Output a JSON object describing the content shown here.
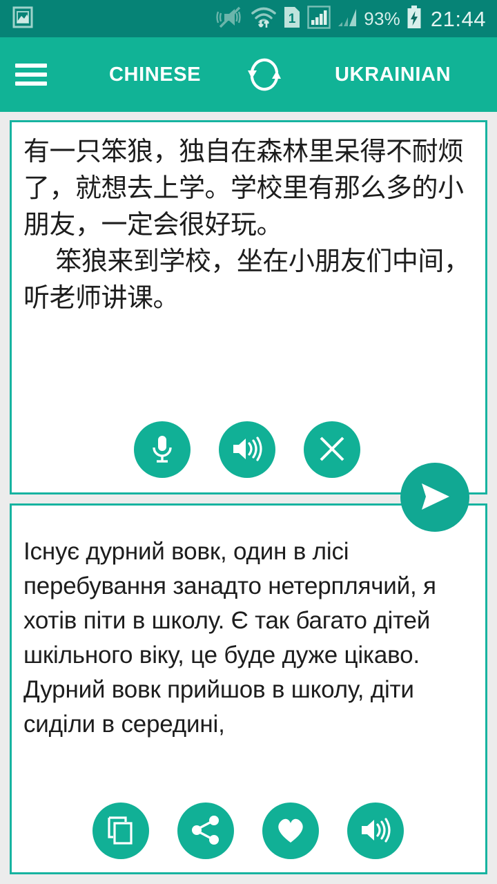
{
  "status_bar": {
    "background": "#068376",
    "left_icons": [
      {
        "name": "screenshot-image-icon"
      }
    ],
    "right_icons": [
      {
        "name": "vibrate-mute-icon"
      },
      {
        "name": "wifi-transfer-icon"
      },
      {
        "name": "sim-card-1-icon",
        "label": "1"
      },
      {
        "name": "signal-bars-sim1-icon"
      },
      {
        "name": "signal-bars-sim2-icon"
      }
    ],
    "battery_percent": "93%",
    "battery_state": "charging",
    "clock": "21:44"
  },
  "appbar": {
    "background": "#11b396",
    "menu_icon": "hamburger-menu-icon",
    "source_language": "CHINESE",
    "swap_icon": "swap-languages-icon",
    "target_language": "UKRAINIAN"
  },
  "source_panel": {
    "border_color": "#16b3a0",
    "text": "有一只笨狼，独自在森林里呆得不耐烦了，就想去上学。学校里有那么多的小朋友，一定会很好玩。\n    笨狼来到学校，坐在小朋友们中间，听老师讲课。",
    "actions": [
      {
        "name": "microphone-button",
        "icon": "microphone-icon"
      },
      {
        "name": "speak-source-button",
        "icon": "speaker-icon"
      },
      {
        "name": "clear-source-button",
        "icon": "close-x-icon"
      }
    ]
  },
  "translate_fab": {
    "name": "translate-send-button",
    "icon": "send-arrow-icon",
    "color": "#11a893"
  },
  "target_panel": {
    "border_color": "#16b3a0",
    "text": "Існує дурний вовк, один в лісі перебування занадто нетерплячий, я хотів піти в школу. Є так багато дітей шкільного віку, це буде дуже цікаво.\nДурний вовк прийшов в школу, діти сиділи в середині,",
    "actions": [
      {
        "name": "copy-button",
        "icon": "copy-icon"
      },
      {
        "name": "share-button",
        "icon": "share-icon"
      },
      {
        "name": "favorite-button",
        "icon": "heart-icon"
      },
      {
        "name": "speak-target-button",
        "icon": "speaker-icon"
      }
    ]
  },
  "theme": {
    "page_background": "#ececec",
    "primary": "#11b396",
    "status_bar": "#068376",
    "button_fill": "#11b096",
    "text_color": "#1d1d1d"
  }
}
